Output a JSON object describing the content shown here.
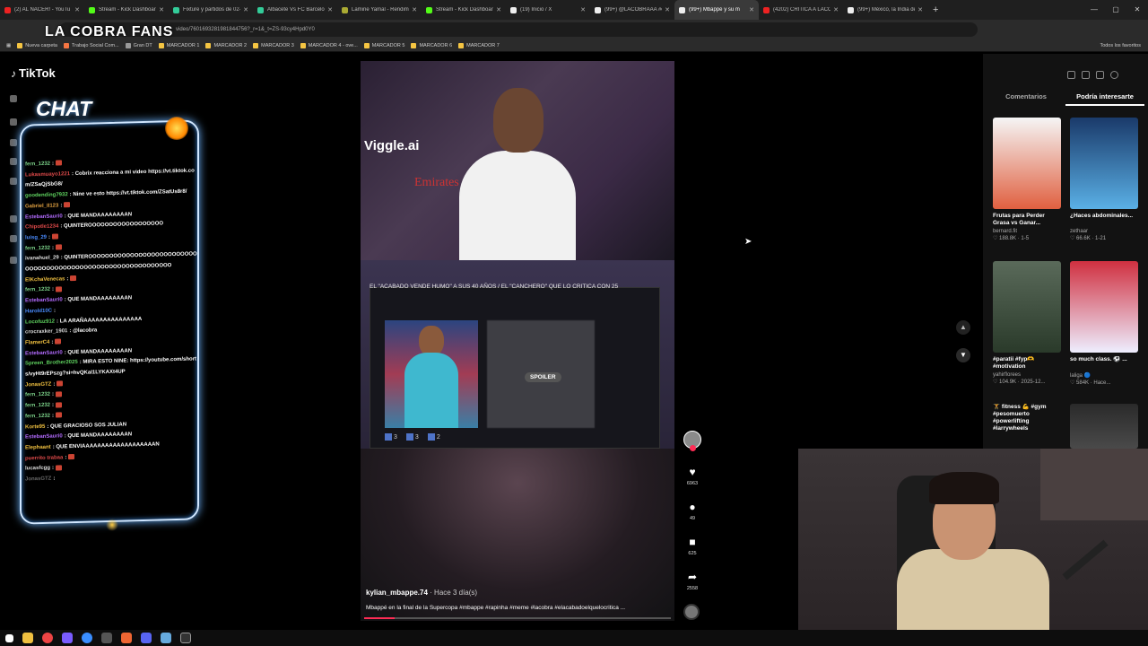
{
  "browser": {
    "tabs": [
      {
        "title": "(2) AL NACER! - YouTu",
        "color": "#e22"
      },
      {
        "title": "Stream - Kick Dashboard",
        "color": "#53fc18"
      },
      {
        "title": "Fixture y partidos de 02-0",
        "color": "#3c9"
      },
      {
        "title": "Albacete Vs FC Barcelona",
        "color": "#3c9"
      },
      {
        "title": "Lamine Yamal - Rendimie",
        "color": "#aa3"
      },
      {
        "title": "Stream - Kick Dashboard",
        "color": "#53fc18"
      },
      {
        "title": "(19) Inicio / X",
        "color": "#eee"
      },
      {
        "title": "(99+) @LACOBRAAA #ca",
        "color": "#eee"
      },
      {
        "title": "(99+) Mbappé y su m",
        "color": "#eee",
        "active": true
      },
      {
        "title": "(4202) CRITICA A LACOBI",
        "color": "#e22"
      },
      {
        "title": "(99+) México, la India de",
        "color": "#eee"
      }
    ],
    "url": "video/7601693281981844756?_r=1&_t=ZS-93cy4Hpd0Y0",
    "bookmarks": [
      {
        "label": "Nueva carpeta",
        "color": "#f5c542"
      },
      {
        "label": "Trabajo Social Com...",
        "color": "#f57542"
      },
      {
        "label": "Gran DT",
        "color": "#999"
      },
      {
        "label": "MARCADOR 1",
        "color": "#f5c542"
      },
      {
        "label": "MARCADOR 2",
        "color": "#f5c542"
      },
      {
        "label": "MARCADOR 3",
        "color": "#f5c542"
      },
      {
        "label": "MARCADOR 4 - ove...",
        "color": "#f5c542"
      },
      {
        "label": "MARCADOR 5",
        "color": "#f5c542"
      },
      {
        "label": "MARCADOR 6",
        "color": "#f5c542"
      },
      {
        "label": "MARCADOR 7",
        "color": "#f5c542"
      }
    ],
    "all_bookmarks": "Todos los favoritos"
  },
  "stream_overlay": {
    "title": "LA COBRA FANS",
    "chat_title": "CHAT"
  },
  "tiktok": {
    "logo": "TikTok",
    "search_placeholder": "Buscar",
    "explore": "Explorar"
  },
  "chat": [
    {
      "user": "fern_1232",
      "text": "",
      "color": "#7cd38a",
      "emote": true
    },
    {
      "user": "Lukasmuayo1221",
      "text": "Cobrix reacciona a mi video https://vt.tiktok.com/ZSaQjSbG8/",
      "color": "#e04a4a"
    },
    {
      "user": "goodending7932",
      "text": "Nine ve esto https://vt.tiktok.com/ZSatUs8r8/",
      "color": "#5fd35f"
    },
    {
      "user": "Gabriel_II123",
      "text": "",
      "color": "#e0a040",
      "emote": true
    },
    {
      "user": "EstebanSauri0",
      "text": "QUE MANDAAAAAAAAN",
      "color": "#b36bff"
    },
    {
      "user": "Chipotle1234",
      "text": "QUINTEROOOOOOOOOOOOOOOOOO",
      "color": "#e04a4a"
    },
    {
      "user": "luisg_29",
      "text": "",
      "color": "#4a8cff",
      "emote": true
    },
    {
      "user": "fern_1232",
      "text": "",
      "color": "#7cd38a",
      "emote": true
    },
    {
      "user": "ivanahuel_29",
      "text": "QUINTEROOOOOOOOOOOOOOOOOOOOOOOOOOOOOOOOOOOOOOOOOOOOOOOOOOOOOOOOOOOOO",
      "color": "#ddd"
    },
    {
      "user": "ElKchaVenecas",
      "text": "",
      "color": "#f0c040",
      "emote": true
    },
    {
      "user": "fern_1232",
      "text": "",
      "color": "#7cd38a",
      "emote": true
    },
    {
      "user": "EstebanSauri0",
      "text": "QUE MANDAAAAAAAAN",
      "color": "#b36bff"
    },
    {
      "user": "Harold10C",
      "text": "",
      "color": "#4a8cff"
    },
    {
      "user": "Locofuz912",
      "text": "LA ARAÑAAAAAAAAAAAAAAA",
      "color": "#5fd35f"
    },
    {
      "user": "crocraxker_1901",
      "text": "@lacobra",
      "color": "#ddd"
    },
    {
      "user": "FlamerC4",
      "text": "",
      "color": "#f0c040",
      "emote": true
    },
    {
      "user": "EstebanSauri0",
      "text": "QUE MANDAAAAAAAAN",
      "color": "#b36bff"
    },
    {
      "user": "Spreen_Brother2025",
      "text": "MIRA ESTO NINE: https://youtube.com/shorts/vyHt9rEPszg?si=hvQKaI1LYKAXt4UP",
      "color": "#5fd35f"
    },
    {
      "user": "JonasGTZ",
      "text": "",
      "color": "#f0c040",
      "emote": true
    },
    {
      "user": "fern_1232",
      "text": "",
      "color": "#7cd38a",
      "emote": true
    },
    {
      "user": "fern_1232",
      "text": "",
      "color": "#7cd38a",
      "emote": true
    },
    {
      "user": "fern_1232",
      "text": "",
      "color": "#7cd38a",
      "emote": true
    },
    {
      "user": "Korte95",
      "text": "QUE GRACIOSO SOS JULIAN",
      "color": "#f0c040"
    },
    {
      "user": "EstebanSauri0",
      "text": "QUE MANDAAAAAAAAN",
      "color": "#b36bff"
    },
    {
      "user": "Elephaant",
      "text": "QUE ENVIAAAAAAAAAAAAAAAAAAAN",
      "color": "#f0c040"
    },
    {
      "user": "puerrito trabaa",
      "text": "",
      "color": "#e04a4a",
      "emote": true
    },
    {
      "user": "lucasfcgg",
      "text": "",
      "color": "#ddd",
      "emote": true
    },
    {
      "user": "JonasGTZ",
      "text": "",
      "color": "#666"
    }
  ],
  "video": {
    "watermark": "Viggle.ai",
    "shirt_text": "Emirates",
    "card_headline": "EL \"ACABADO VENDE HUMO\" A SUS 40 AÑOS / EL \"CANCHERO\" QUE LO CRITICA CON 25",
    "spoiler": "SPOILER",
    "card_stats": [
      "3",
      "3",
      "2"
    ],
    "author": "kylian_mbappe.74",
    "time_ago": "· Hace 3 día(s)",
    "caption": "Mbappé en la final de la Supercopa #mbappe #rapinha #meme #lacobra #elacabadoelquelocritica ...",
    "progress": 0.1
  },
  "actions": {
    "likes": "6963",
    "comments": "49",
    "saves": "625",
    "shares": "2558"
  },
  "right_panel": {
    "tabs": [
      "Comentarios",
      "Podría interesarte"
    ],
    "active_tab": 1,
    "cards": [
      {
        "caption": "Frutas para Perder Grasa vs Ganar...",
        "author": "bernard.fit",
        "meta": "♡ 188.8K · 1-5",
        "bg": "linear-gradient(180deg,#f5f5f5,#e06040)"
      },
      {
        "caption": "¿Haces abdominales...",
        "author": "zethaar",
        "meta": "♡ 66.6K · 1-21",
        "bg": "linear-gradient(180deg,#1a3a6a,#5ab0e6)"
      },
      {
        "caption": "#paratii #fyp🫶 #motivation",
        "author": "yahirflorees",
        "meta": "♡ 104.9K · 2025-12...",
        "bg": "linear-gradient(180deg,#5a6a5a,#2a3a2a)"
      },
      {
        "caption": "so much class. ⚽ ...",
        "author": "laliga 🔵",
        "meta": "♡ 584K · Hace...",
        "bg": "linear-gradient(180deg,#d03040,#eef)"
      },
      {
        "caption": "🏋️ fitness 💪 #gym #pesomuerto #powerlifting #larrywheels",
        "author": "",
        "meta": "",
        "bg": "#121212"
      },
      {
        "caption": "",
        "author": "",
        "meta": "",
        "bg": "linear-gradient(180deg,#2a2a2a,#4a4a4a)"
      }
    ]
  }
}
